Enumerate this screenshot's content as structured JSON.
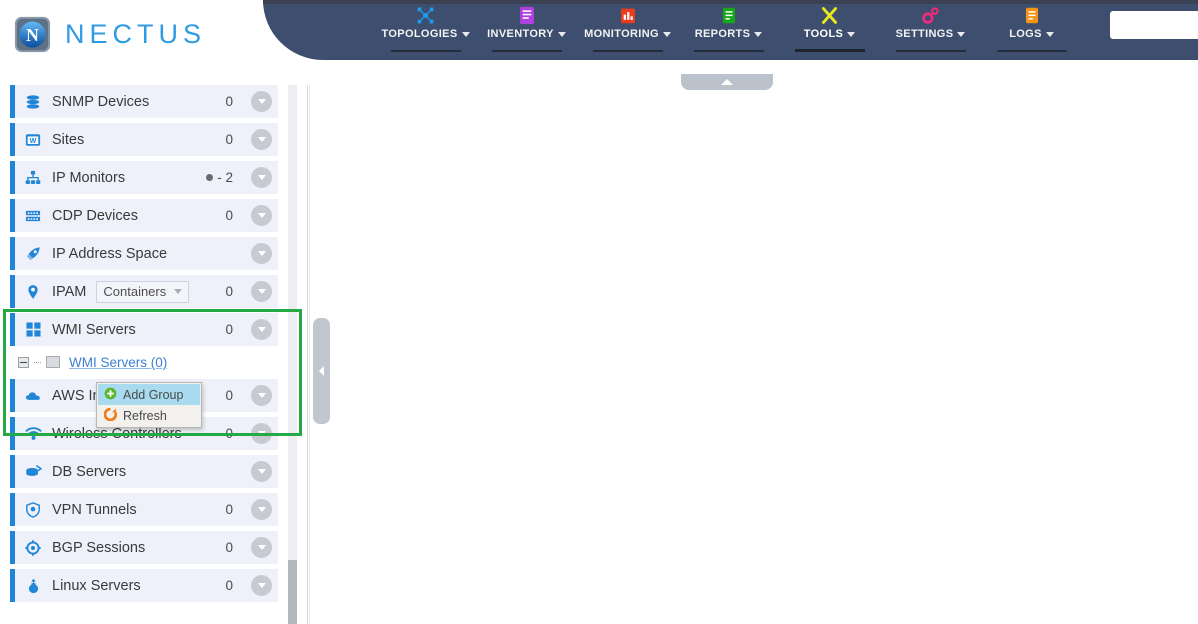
{
  "brand": {
    "name": "NECTUS",
    "logo_icon": "nectus-logo-icon",
    "accent": "#2f9be5"
  },
  "navbar": {
    "background": "#3e4e6e",
    "items": [
      {
        "label": "TOPOLOGIES",
        "icon": "topology-icon",
        "icon_color": "#1d9bf0",
        "active": false
      },
      {
        "label": "INVENTORY",
        "icon": "inventory-icon",
        "icon_color": "#b040e0",
        "active": false
      },
      {
        "label": "MONITORING",
        "icon": "monitoring-icon",
        "icon_color": "#f03b1a",
        "active": false
      },
      {
        "label": "REPORTS",
        "icon": "reports-icon",
        "icon_color": "#17a81a",
        "active": false
      },
      {
        "label": "TOOLS",
        "icon": "tools-icon",
        "icon_color": "#e8e81a",
        "active": true
      },
      {
        "label": "SETTINGS",
        "icon": "settings-icon",
        "icon_color": "#ee2a7b",
        "active": false
      },
      {
        "label": "LOGS",
        "icon": "logs-icon",
        "icon_color": "#f0941a",
        "active": false
      }
    ],
    "search": {
      "value": "",
      "placeholder": "",
      "button_icon": "search-icon",
      "button_color": "#3b86c8"
    }
  },
  "handles": {
    "top_collapse": {
      "icon": "chevron-up-icon",
      "name": "top-panel-collapse-handle"
    },
    "side_collapse": {
      "icon": "chevron-left-icon",
      "name": "sidebar-collapse-handle"
    }
  },
  "sidebar": {
    "accent_color": "#2186d8",
    "row_background": "#eef1f9",
    "items": [
      {
        "label": "SNMP Devices",
        "icon": "database-icon",
        "count": "0",
        "has_dot": false,
        "chevron": true
      },
      {
        "label": "Sites",
        "icon": "site-icon",
        "count": "0",
        "has_dot": false,
        "chevron": true
      },
      {
        "label": "IP Monitors",
        "icon": "network-icon",
        "count": "- 2",
        "has_dot": true,
        "chevron": true
      },
      {
        "label": "CDP Devices",
        "icon": "switch-icon",
        "count": "0",
        "has_dot": false,
        "chevron": true
      },
      {
        "label": "IP Address Space",
        "icon": "rocket-icon",
        "count": "",
        "has_dot": false,
        "chevron": true
      },
      {
        "label": "IPAM",
        "icon": "map-pin-icon",
        "count": "0",
        "has_dot": false,
        "chevron": true,
        "select": {
          "label": "Containers",
          "icon": "chevron-down-icon"
        }
      },
      {
        "label": "WMI Servers",
        "icon": "windows-icon",
        "count": "0",
        "has_dot": false,
        "chevron": true
      },
      {
        "label": "AWS Instances",
        "icon": "cloud-icon",
        "count": "0",
        "has_dot": false,
        "chevron": true
      },
      {
        "label": "Wireless Controllers",
        "icon": "wifi-icon",
        "count": "0",
        "has_dot": false,
        "chevron": true
      },
      {
        "label": "DB Servers",
        "icon": "db-server-icon",
        "count": "",
        "has_dot": false,
        "chevron": true
      },
      {
        "label": "VPN Tunnels",
        "icon": "shield-icon",
        "count": "0",
        "has_dot": false,
        "chevron": true
      },
      {
        "label": "BGP Sessions",
        "icon": "bgp-icon",
        "count": "0",
        "has_dot": false,
        "chevron": true
      },
      {
        "label": "Linux Servers",
        "icon": "linux-icon",
        "count": "0",
        "has_dot": false,
        "chevron": true
      }
    ],
    "tree_node": {
      "label": "WMI Servers (0)",
      "expander_icon": "collapse-minus-icon",
      "folder_icon": "folder-icon"
    }
  },
  "highlight": {
    "color": "#23aa44",
    "name": "green-highlight-box"
  },
  "context_menu": {
    "items": [
      {
        "label": "Add Group",
        "icon": "plus-circle-icon",
        "icon_color": "#5bb52a",
        "hovered": true
      },
      {
        "label": "Refresh",
        "icon": "refresh-icon",
        "icon_color": "#f07d1a",
        "hovered": false
      }
    ]
  },
  "scrollbar": {
    "track_color": "#eceef1",
    "thumb_color": "#b3b8bf"
  }
}
